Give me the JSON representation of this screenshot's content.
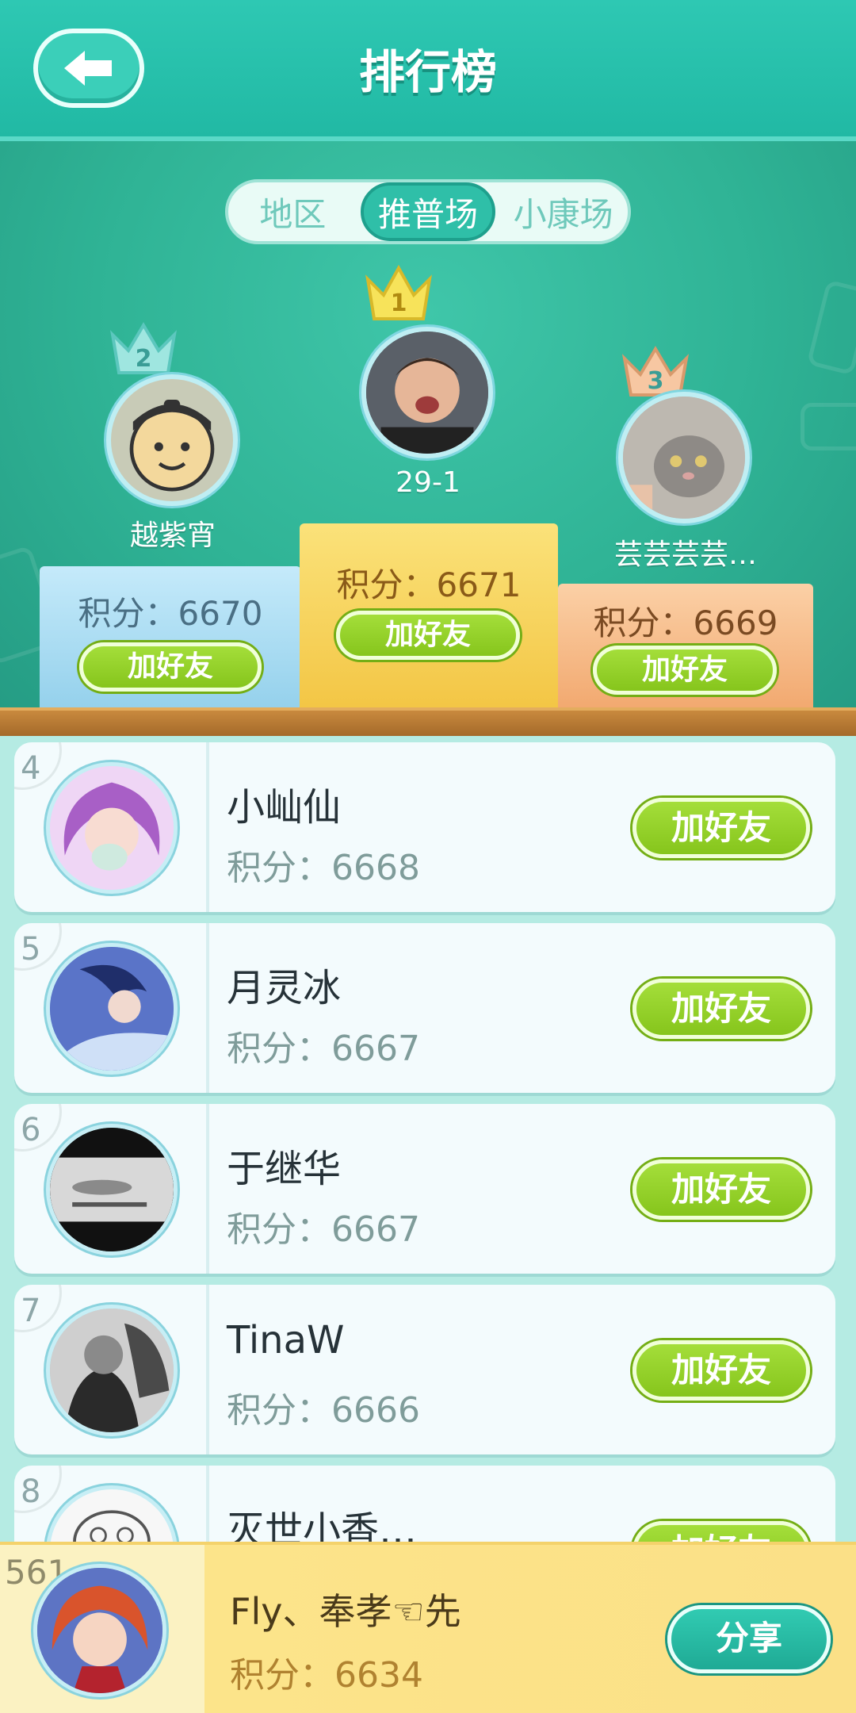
{
  "header": {
    "title": "排行榜",
    "back_icon": "back-arrow-icon"
  },
  "tabs": [
    {
      "label": "地区",
      "active": false
    },
    {
      "label": "推普场",
      "active": true
    },
    {
      "label": "小康场",
      "active": false
    }
  ],
  "podium": {
    "first": {
      "rank": "1",
      "name": "29-1",
      "score_text": "积分：6671",
      "button": "加好友"
    },
    "second": {
      "rank": "2",
      "name": "越紫宵",
      "score_text": "积分：6670",
      "button": "加好友"
    },
    "third": {
      "rank": "3",
      "name": "芸芸芸芸…",
      "score_text": "积分：6669",
      "button": "加好友"
    }
  },
  "list": [
    {
      "rank": "4",
      "name": "小屾仙",
      "score_text": "积分：6668",
      "button": "加好友"
    },
    {
      "rank": "5",
      "name": "月灵冰",
      "score_text": "积分：6667",
      "button": "加好友"
    },
    {
      "rank": "6",
      "name": "于继华",
      "score_text": "积分：6667",
      "button": "加好友"
    },
    {
      "rank": "7",
      "name": "TinaW",
      "score_text": "积分：6666",
      "button": "加好友"
    },
    {
      "rank": "8",
      "name": "灭世小香…",
      "score_text": "",
      "button": "加好友"
    }
  ],
  "me": {
    "rank": "561",
    "name": "Fly、奉孝☜先",
    "score_text": "积分：6634",
    "share": "分享"
  },
  "colors": {
    "teal": "#2ec8b3",
    "green_button": "#94d22a",
    "gold": "#f5c94e",
    "blue_block": "#a8dcef",
    "orange_block": "#f7b98a"
  }
}
